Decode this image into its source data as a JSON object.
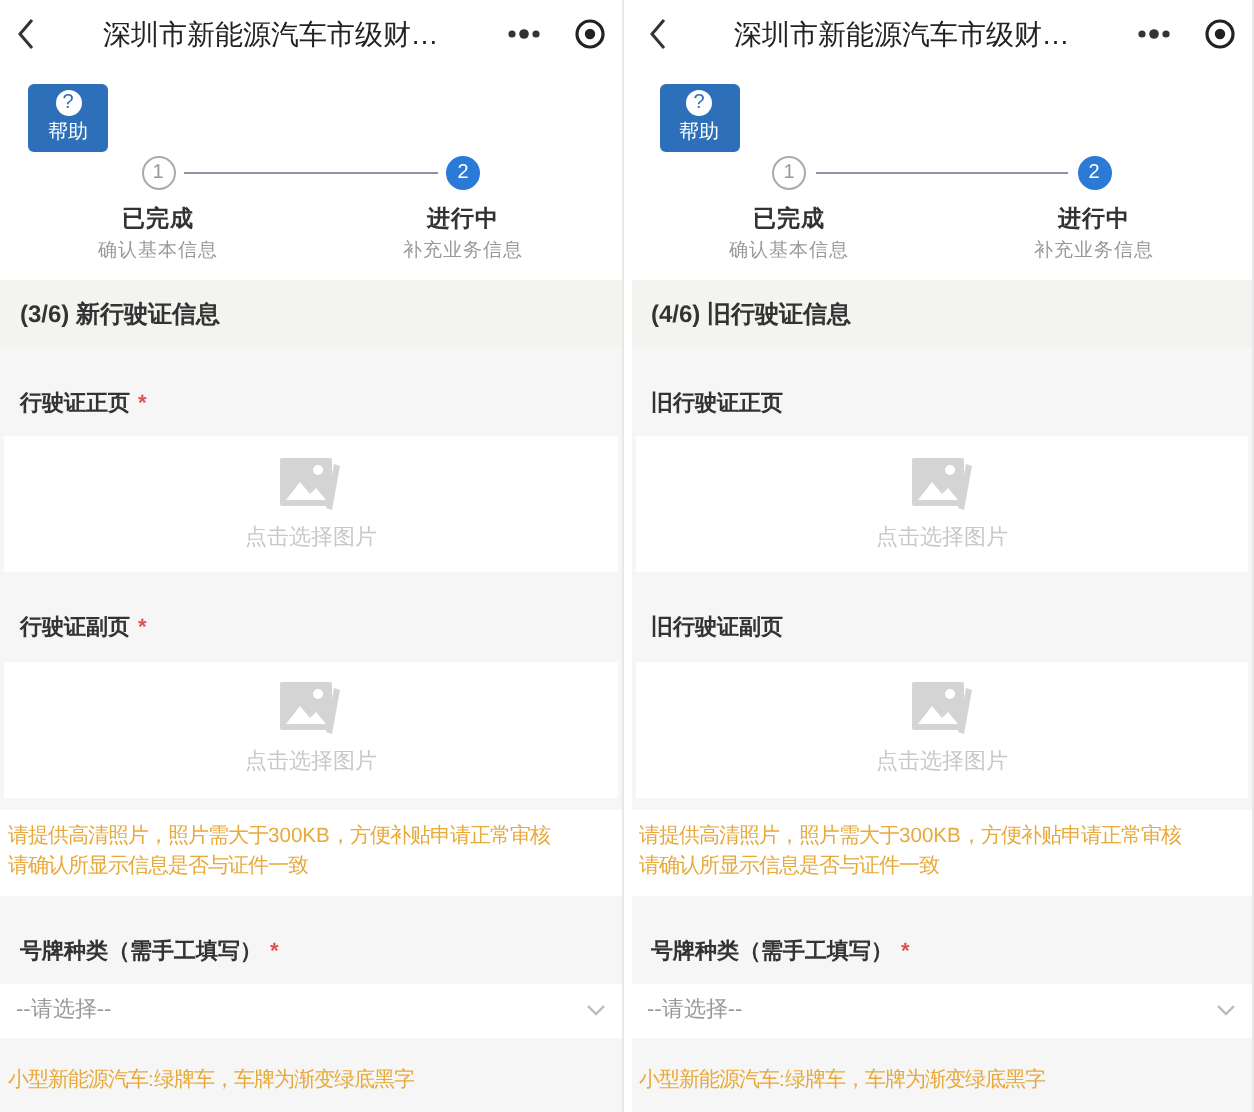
{
  "screens": [
    {
      "title": "深圳市新能源汽车市级财…",
      "help_glyph": "?",
      "help_label": "帮助",
      "steps": [
        {
          "number": "1",
          "label": "已完成",
          "sub": "确认基本信息",
          "active": false
        },
        {
          "number": "2",
          "label": "进行中",
          "sub": "补充业务信息",
          "active": true
        }
      ],
      "section": "(3/6)  新行驶证信息",
      "items": [
        {
          "kind": "upload",
          "label": "行驶证正页",
          "required_mark": "*",
          "text": "点击选择图片"
        },
        {
          "kind": "upload",
          "label": "行驶证副页",
          "required_mark": "*",
          "text": "点击选择图片"
        },
        {
          "kind": "note",
          "lines": [
            "请提供高清照片，照片需大于300KB，方便补贴申请正常审核",
            "请确认所显示信息是否与证件一致"
          ]
        },
        {
          "kind": "select",
          "label": "号牌种类（需手工填写）",
          "required_mark": "*",
          "placeholder": "--请选择--"
        },
        {
          "kind": "note",
          "lines": [
            "小型新能源汽车:绿牌车，车牌为渐变绿底黑字"
          ]
        }
      ]
    },
    {
      "title": "深圳市新能源汽车市级财…",
      "help_glyph": "?",
      "help_label": "帮助",
      "steps": [
        {
          "number": "1",
          "label": "已完成",
          "sub": "确认基本信息",
          "active": false
        },
        {
          "number": "2",
          "label": "进行中",
          "sub": "补充业务信息",
          "active": true
        }
      ],
      "section": "(4/6)  旧行驶证信息",
      "items": [
        {
          "kind": "upload",
          "label": "旧行驶证正页",
          "text": "点击选择图片"
        },
        {
          "kind": "upload",
          "label": "旧行驶证副页",
          "text": "点击选择图片"
        },
        {
          "kind": "note",
          "lines": [
            "请提供高清照片，照片需大于300KB，方便补贴申请正常审核",
            "请确认所显示信息是否与证件一致"
          ]
        },
        {
          "kind": "select",
          "label": "号牌种类（需手工填写）",
          "required_mark": "*",
          "placeholder": "--请选择--"
        },
        {
          "kind": "note",
          "lines": [
            "小型新能源汽车:绿牌车，车牌为渐变绿底黑字"
          ]
        }
      ]
    }
  ]
}
